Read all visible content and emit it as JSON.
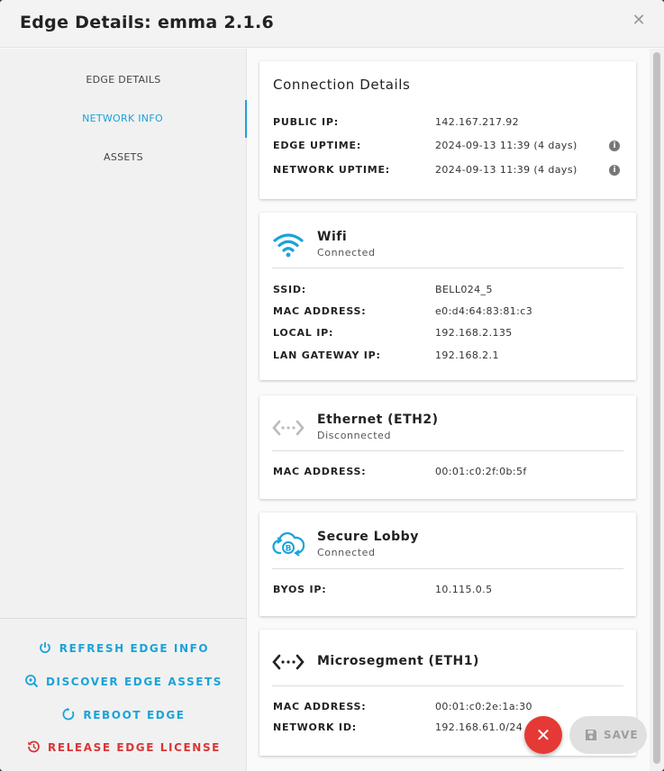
{
  "dialog": {
    "title": "Edge Details: emma 2.1.6",
    "close_icon": "close-icon"
  },
  "nav": {
    "items": [
      {
        "label": "EDGE DETAILS",
        "active": false
      },
      {
        "label": "NETWORK INFO",
        "active": true
      },
      {
        "label": "ASSETS",
        "active": false
      }
    ],
    "actions": [
      {
        "label": "REFRESH EDGE INFO",
        "icon": "refresh-icon",
        "color": "#1aa3d9"
      },
      {
        "label": "DISCOVER EDGE ASSETS",
        "icon": "discover-icon",
        "color": "#1aa3d9"
      },
      {
        "label": "REBOOT EDGE",
        "icon": "reboot-icon",
        "color": "#1aa3d9"
      },
      {
        "label": "RELEASE EDGE LICENSE",
        "icon": "release-icon",
        "color": "#d93636"
      }
    ]
  },
  "connection_details": {
    "title": "Connection Details",
    "rows": [
      {
        "label": "PUBLIC IP:",
        "value": "142.167.217.92"
      },
      {
        "label": "EDGE UPTIME:",
        "value": "2024-09-13 11:39 (4 days)"
      },
      {
        "label": "NETWORK UPTIME:",
        "value": "2024-09-13 11:39 (4 days)"
      }
    ]
  },
  "wifi": {
    "name": "Wifi",
    "status": "Connected",
    "icon": "wifi-icon",
    "rows": [
      {
        "label": "SSID:",
        "value": "BELL024_5"
      },
      {
        "label": "MAC ADDRESS:",
        "value": "e0:d4:64:83:81:c3"
      },
      {
        "label": "LOCAL IP:",
        "value": "192.168.2.135"
      },
      {
        "label": "LAN GATEWAY IP:",
        "value": "192.168.2.1"
      }
    ]
  },
  "ethernet": {
    "name": "Ethernet (ETH2)",
    "status": "Disconnected",
    "icon": "ethernet-icon",
    "rows": [
      {
        "label": "MAC ADDRESS:",
        "value": "00:01:c0:2f:0b:5f"
      }
    ]
  },
  "secure_lobby": {
    "name": "Secure Lobby",
    "status": "Connected",
    "icon": "secure-lobby-cloud-icon",
    "rows": [
      {
        "label": "BYOS IP:",
        "value": "10.115.0.5"
      }
    ]
  },
  "microsegment": {
    "name": "Microsegment (ETH1)",
    "icon": "microsegment-icon",
    "rows": [
      {
        "label": "MAC ADDRESS:",
        "value": "00:01:c0:2e:1a:30"
      },
      {
        "label": "NETWORK ID:",
        "value": "192.168.61.0/24"
      }
    ]
  },
  "footer": {
    "fab_icon": "close-icon",
    "save_label": "SAVE"
  },
  "colors": {
    "accent": "#1aa3d9",
    "danger": "#d93636",
    "fab": "#e53935"
  }
}
